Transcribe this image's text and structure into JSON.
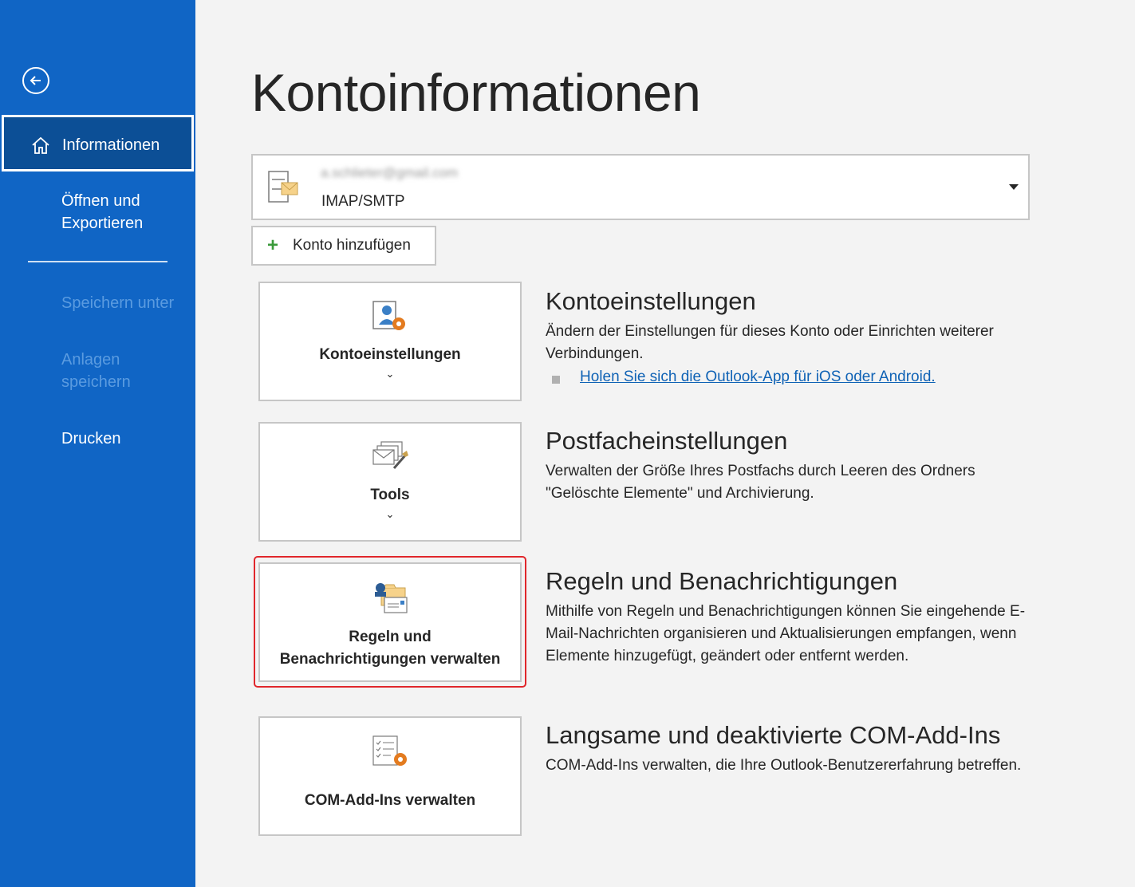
{
  "sidebar": {
    "back_label": "Zurück",
    "items": [
      {
        "label": "Informationen"
      },
      {
        "label": "Öffnen und Exportieren"
      },
      {
        "label": "Speichern unter"
      },
      {
        "label": "Anlagen speichern"
      },
      {
        "label": "Drucken"
      }
    ]
  },
  "main": {
    "title": "Kontoinformationen",
    "account": {
      "email": "a.schlieter@gmail.com",
      "type": "IMAP/SMTP"
    },
    "add_account_label": "Konto hinzufügen",
    "sections": [
      {
        "card_label": "Kontoeinstellungen",
        "card_chevron": "⌄",
        "heading": "Kontoeinstellungen",
        "description": "Ändern der Einstellungen für dieses Konto oder Einrichten weiterer Verbindungen.",
        "link": "Holen Sie sich die Outlook-App für iOS oder Android."
      },
      {
        "card_label": "Tools",
        "card_chevron": "⌄",
        "heading": "Postfacheinstellungen",
        "description": "Verwalten der Größe Ihres Postfachs durch Leeren des Ordners \"Gelöschte Elemente\" und Archivierung."
      },
      {
        "card_label_line1": "Regeln und",
        "card_label_line2": "Benachrichtigungen verwalten",
        "heading": "Regeln und Benachrichtigungen",
        "description": "Mithilfe von Regeln und Benachrichtigungen können Sie eingehende E-Mail-Nachrichten organisieren und Aktualisierungen empfangen, wenn Elemente hinzugefügt, geändert oder entfernt werden."
      },
      {
        "card_label": "COM-Add-Ins verwalten",
        "heading": "Langsame und deaktivierte COM-Add-Ins",
        "description": "COM-Add-Ins verwalten, die Ihre Outlook-Benutzererfahrung betreffen."
      }
    ]
  },
  "colors": {
    "sidebar": "#1065c5",
    "sidebar_active": "#0c4f96",
    "highlight": "#e0262b",
    "link": "#0f62b5"
  }
}
